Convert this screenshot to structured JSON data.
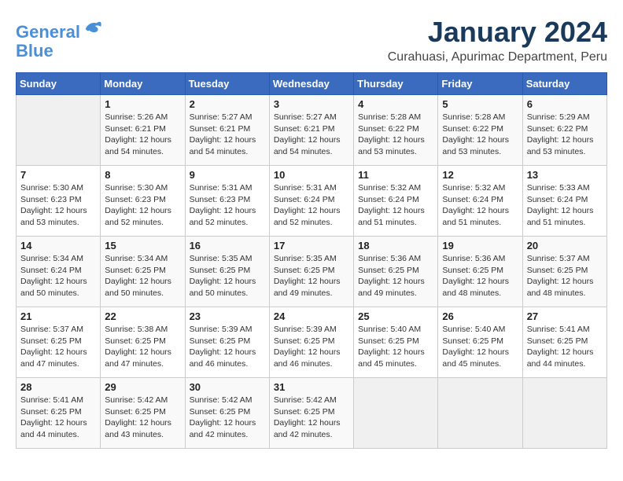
{
  "logo": {
    "line1": "General",
    "line2": "Blue"
  },
  "title": "January 2024",
  "subtitle": "Curahuasi, Apurimac Department, Peru",
  "weekdays": [
    "Sunday",
    "Monday",
    "Tuesday",
    "Wednesday",
    "Thursday",
    "Friday",
    "Saturday"
  ],
  "weeks": [
    [
      {
        "day": "",
        "info": ""
      },
      {
        "day": "1",
        "info": "Sunrise: 5:26 AM\nSunset: 6:21 PM\nDaylight: 12 hours\nand 54 minutes."
      },
      {
        "day": "2",
        "info": "Sunrise: 5:27 AM\nSunset: 6:21 PM\nDaylight: 12 hours\nand 54 minutes."
      },
      {
        "day": "3",
        "info": "Sunrise: 5:27 AM\nSunset: 6:21 PM\nDaylight: 12 hours\nand 54 minutes."
      },
      {
        "day": "4",
        "info": "Sunrise: 5:28 AM\nSunset: 6:22 PM\nDaylight: 12 hours\nand 53 minutes."
      },
      {
        "day": "5",
        "info": "Sunrise: 5:28 AM\nSunset: 6:22 PM\nDaylight: 12 hours\nand 53 minutes."
      },
      {
        "day": "6",
        "info": "Sunrise: 5:29 AM\nSunset: 6:22 PM\nDaylight: 12 hours\nand 53 minutes."
      }
    ],
    [
      {
        "day": "7",
        "info": "Sunrise: 5:30 AM\nSunset: 6:23 PM\nDaylight: 12 hours\nand 53 minutes."
      },
      {
        "day": "8",
        "info": "Sunrise: 5:30 AM\nSunset: 6:23 PM\nDaylight: 12 hours\nand 52 minutes."
      },
      {
        "day": "9",
        "info": "Sunrise: 5:31 AM\nSunset: 6:23 PM\nDaylight: 12 hours\nand 52 minutes."
      },
      {
        "day": "10",
        "info": "Sunrise: 5:31 AM\nSunset: 6:24 PM\nDaylight: 12 hours\nand 52 minutes."
      },
      {
        "day": "11",
        "info": "Sunrise: 5:32 AM\nSunset: 6:24 PM\nDaylight: 12 hours\nand 51 minutes."
      },
      {
        "day": "12",
        "info": "Sunrise: 5:32 AM\nSunset: 6:24 PM\nDaylight: 12 hours\nand 51 minutes."
      },
      {
        "day": "13",
        "info": "Sunrise: 5:33 AM\nSunset: 6:24 PM\nDaylight: 12 hours\nand 51 minutes."
      }
    ],
    [
      {
        "day": "14",
        "info": "Sunrise: 5:34 AM\nSunset: 6:24 PM\nDaylight: 12 hours\nand 50 minutes."
      },
      {
        "day": "15",
        "info": "Sunrise: 5:34 AM\nSunset: 6:25 PM\nDaylight: 12 hours\nand 50 minutes."
      },
      {
        "day": "16",
        "info": "Sunrise: 5:35 AM\nSunset: 6:25 PM\nDaylight: 12 hours\nand 50 minutes."
      },
      {
        "day": "17",
        "info": "Sunrise: 5:35 AM\nSunset: 6:25 PM\nDaylight: 12 hours\nand 49 minutes."
      },
      {
        "day": "18",
        "info": "Sunrise: 5:36 AM\nSunset: 6:25 PM\nDaylight: 12 hours\nand 49 minutes."
      },
      {
        "day": "19",
        "info": "Sunrise: 5:36 AM\nSunset: 6:25 PM\nDaylight: 12 hours\nand 48 minutes."
      },
      {
        "day": "20",
        "info": "Sunrise: 5:37 AM\nSunset: 6:25 PM\nDaylight: 12 hours\nand 48 minutes."
      }
    ],
    [
      {
        "day": "21",
        "info": "Sunrise: 5:37 AM\nSunset: 6:25 PM\nDaylight: 12 hours\nand 47 minutes."
      },
      {
        "day": "22",
        "info": "Sunrise: 5:38 AM\nSunset: 6:25 PM\nDaylight: 12 hours\nand 47 minutes."
      },
      {
        "day": "23",
        "info": "Sunrise: 5:39 AM\nSunset: 6:25 PM\nDaylight: 12 hours\nand 46 minutes."
      },
      {
        "day": "24",
        "info": "Sunrise: 5:39 AM\nSunset: 6:25 PM\nDaylight: 12 hours\nand 46 minutes."
      },
      {
        "day": "25",
        "info": "Sunrise: 5:40 AM\nSunset: 6:25 PM\nDaylight: 12 hours\nand 45 minutes."
      },
      {
        "day": "26",
        "info": "Sunrise: 5:40 AM\nSunset: 6:25 PM\nDaylight: 12 hours\nand 45 minutes."
      },
      {
        "day": "27",
        "info": "Sunrise: 5:41 AM\nSunset: 6:25 PM\nDaylight: 12 hours\nand 44 minutes."
      }
    ],
    [
      {
        "day": "28",
        "info": "Sunrise: 5:41 AM\nSunset: 6:25 PM\nDaylight: 12 hours\nand 44 minutes."
      },
      {
        "day": "29",
        "info": "Sunrise: 5:42 AM\nSunset: 6:25 PM\nDaylight: 12 hours\nand 43 minutes."
      },
      {
        "day": "30",
        "info": "Sunrise: 5:42 AM\nSunset: 6:25 PM\nDaylight: 12 hours\nand 42 minutes."
      },
      {
        "day": "31",
        "info": "Sunrise: 5:42 AM\nSunset: 6:25 PM\nDaylight: 12 hours\nand 42 minutes."
      },
      {
        "day": "",
        "info": ""
      },
      {
        "day": "",
        "info": ""
      },
      {
        "day": "",
        "info": ""
      }
    ]
  ]
}
